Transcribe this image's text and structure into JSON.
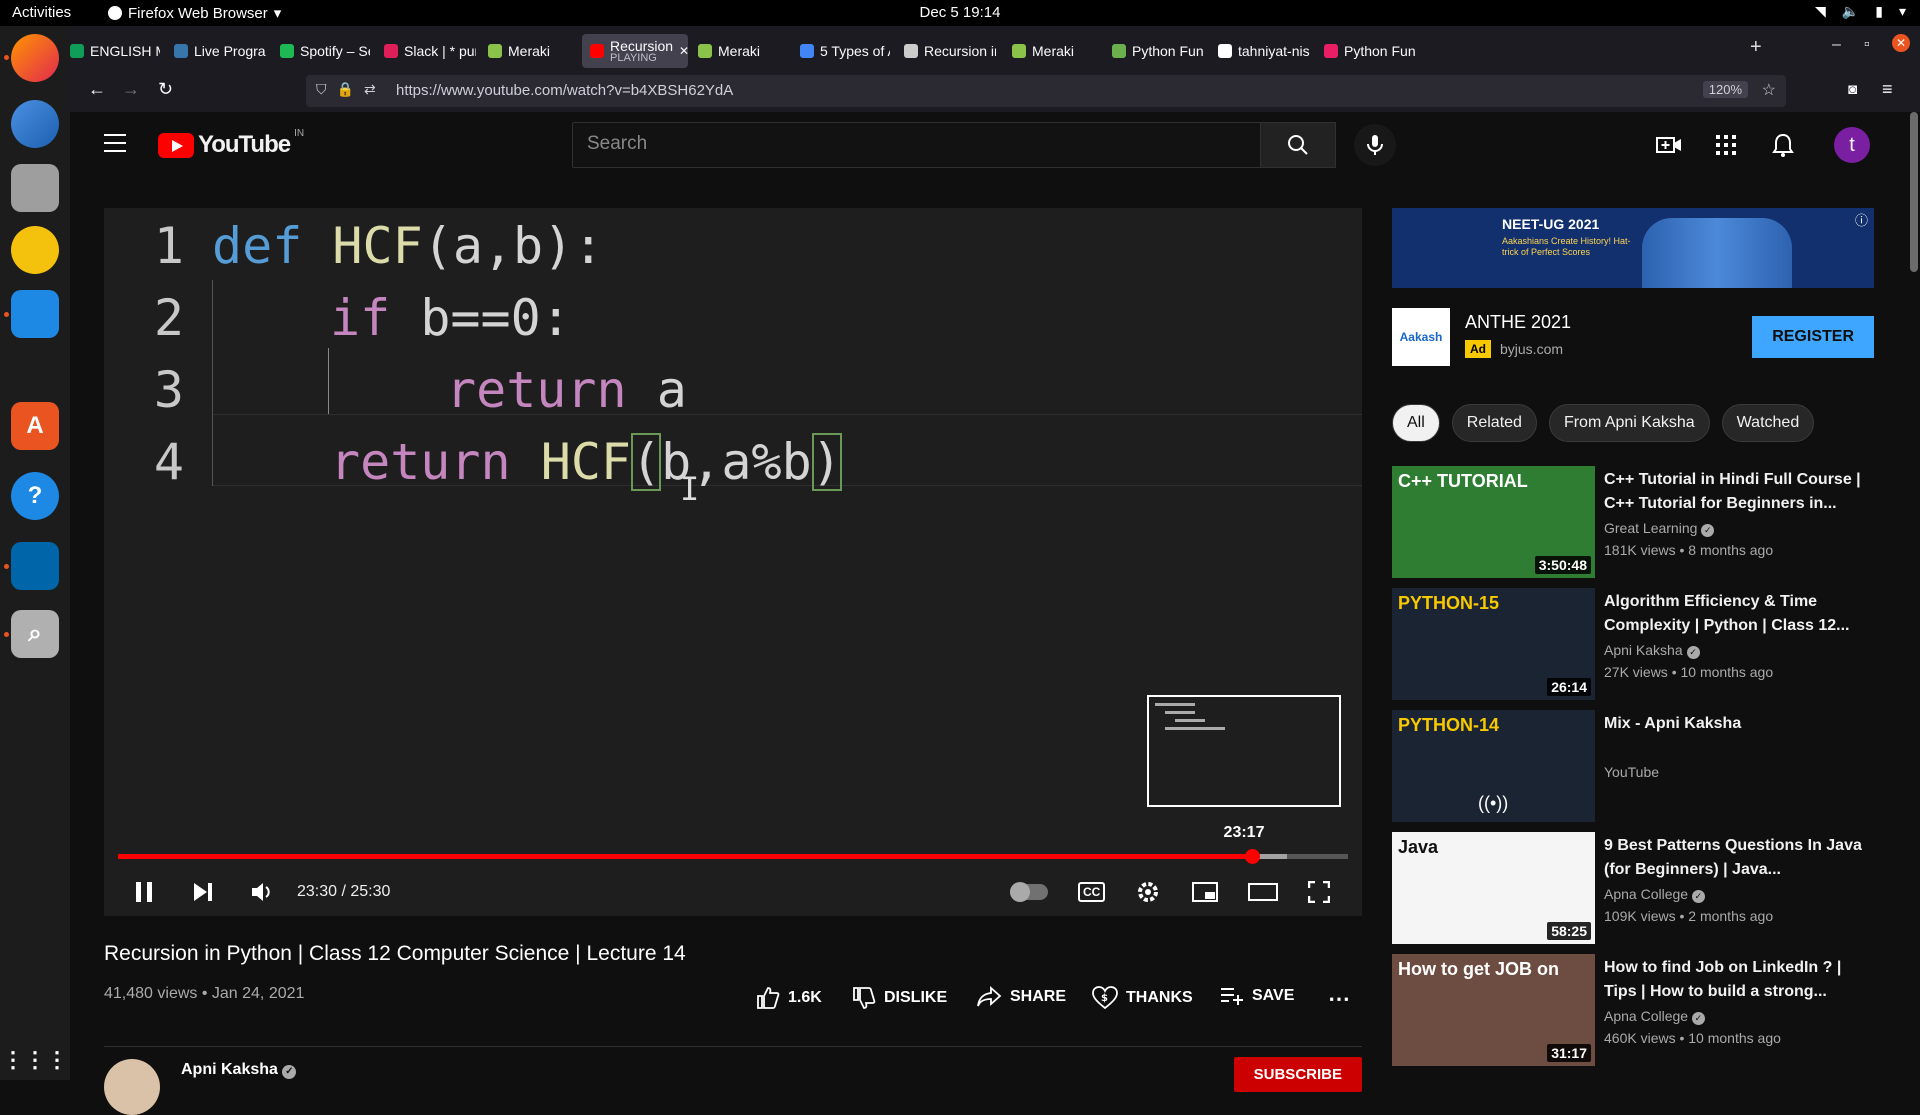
{
  "system": {
    "activities": "Activities",
    "app_name": "Firefox Web Browser",
    "clock": "Dec 5  19:14"
  },
  "browser": {
    "tabs": [
      {
        "label": "ENGLISH ME",
        "color": "#0f9d58"
      },
      {
        "label": "Live Program",
        "color": "#3776ab"
      },
      {
        "label": "Spotify – Sea",
        "color": "#1db954"
      },
      {
        "label": "Slack | * pun",
        "color": "#e01e5a"
      },
      {
        "label": "Meraki",
        "color": "#8bc34a"
      },
      {
        "label": "Recursion",
        "sub": "PLAYING",
        "color": "#ff0000",
        "active": true
      },
      {
        "label": "Meraki",
        "color": "#8bc34a"
      },
      {
        "label": "5 Types of A",
        "color": "#4285f4"
      },
      {
        "label": "Recursion in",
        "color": "#cccccc"
      },
      {
        "label": "Meraki",
        "color": "#8bc34a"
      },
      {
        "label": "Python Func",
        "color": "#6ab04c"
      },
      {
        "label": "tahniyat-nisa",
        "color": "#ffffff"
      },
      {
        "label": "Python Func",
        "color": "#e91e63"
      }
    ],
    "url": "https://www.youtube.com/watch?v=b4XBSH62YdA",
    "zoom": "120%"
  },
  "youtube": {
    "country": "IN",
    "search_placeholder": "Search",
    "avatar_letter": "t"
  },
  "video": {
    "code_lines": [
      {
        "n": "1"
      },
      {
        "n": "2"
      },
      {
        "n": "3"
      },
      {
        "n": "4"
      }
    ],
    "code": {
      "l1_kw": "def",
      "l1_fn": "HCF",
      "l1_rest": "(a,b):",
      "l2_kw": "if",
      "l2_rest": " b==0:",
      "l3_kw": "return",
      "l3_rest": " a",
      "l4_kw": "return",
      "l4_fn": " HCF",
      "l4_open": "(",
      "l4_args": "b,a%b",
      "l4_close": ")"
    },
    "preview_time": "23:17",
    "time_display": "23:30 / 25:30",
    "progress_fraction": 0.9216,
    "buffer_fraction": 0.95,
    "title": "Recursion in Python | Class 12 Computer Science | Lecture 14",
    "meta": "41,480 views • Jan 24, 2021",
    "likes": "1.6K",
    "dislike": "DISLIKE",
    "share": "SHARE",
    "thanks": "THANKS",
    "save": "SAVE",
    "channel": "Apni Kaksha",
    "subscribe": "SUBSCRIBE"
  },
  "ad": {
    "banner_title": "NEET-UG 2021",
    "banner_sub": "Aakashians Create History! Hat-trick of Perfect Scores",
    "logo_text": "Aakash",
    "title": "ANTHE 2021",
    "badge": "Ad",
    "domain": "byjus.com",
    "cta": "REGISTER"
  },
  "chips": [
    "All",
    "Related",
    "From Apni Kaksha",
    "Watched"
  ],
  "recommendations": [
    {
      "title": "C++ Tutorial in Hindi Full Course | C++ Tutorial for Beginners in...",
      "channel": "Great Learning",
      "meta": "181K views • 8 months ago",
      "duration": "3:50:48",
      "thumb_text": "C++ TUTORIAL",
      "thumb_bg": "#2e7d32",
      "thumb_fg": "#ffffff"
    },
    {
      "title": "Algorithm Efficiency & Time Complexity | Python | Class 12...",
      "channel": "Apni Kaksha",
      "meta": "27K views • 10 months ago",
      "duration": "26:14",
      "thumb_text": "PYTHON-15",
      "thumb_bg": "#1a2433",
      "thumb_fg": "#f9c900"
    },
    {
      "title": "Mix - Apni Kaksha",
      "channel": "YouTube",
      "meta": "",
      "duration": "",
      "thumb_text": "PYTHON-14",
      "thumb_bg": "#1a2433",
      "thumb_fg": "#f9c900"
    },
    {
      "title": "9 Best Patterns Questions In Java (for Beginners) | Java...",
      "channel": "Apna College",
      "meta": "109K views • 2 months ago",
      "duration": "58:25",
      "thumb_text": "Java",
      "thumb_bg": "#f5f5f5",
      "thumb_fg": "#111111"
    },
    {
      "title": "How to find Job on LinkedIn ? | Tips | How to build a strong...",
      "channel": "Apna College",
      "meta": "460K views • 10 months ago",
      "duration": "31:17",
      "thumb_text": "How to get JOB on",
      "thumb_bg": "#6d4c41",
      "thumb_fg": "#ffffff"
    }
  ]
}
